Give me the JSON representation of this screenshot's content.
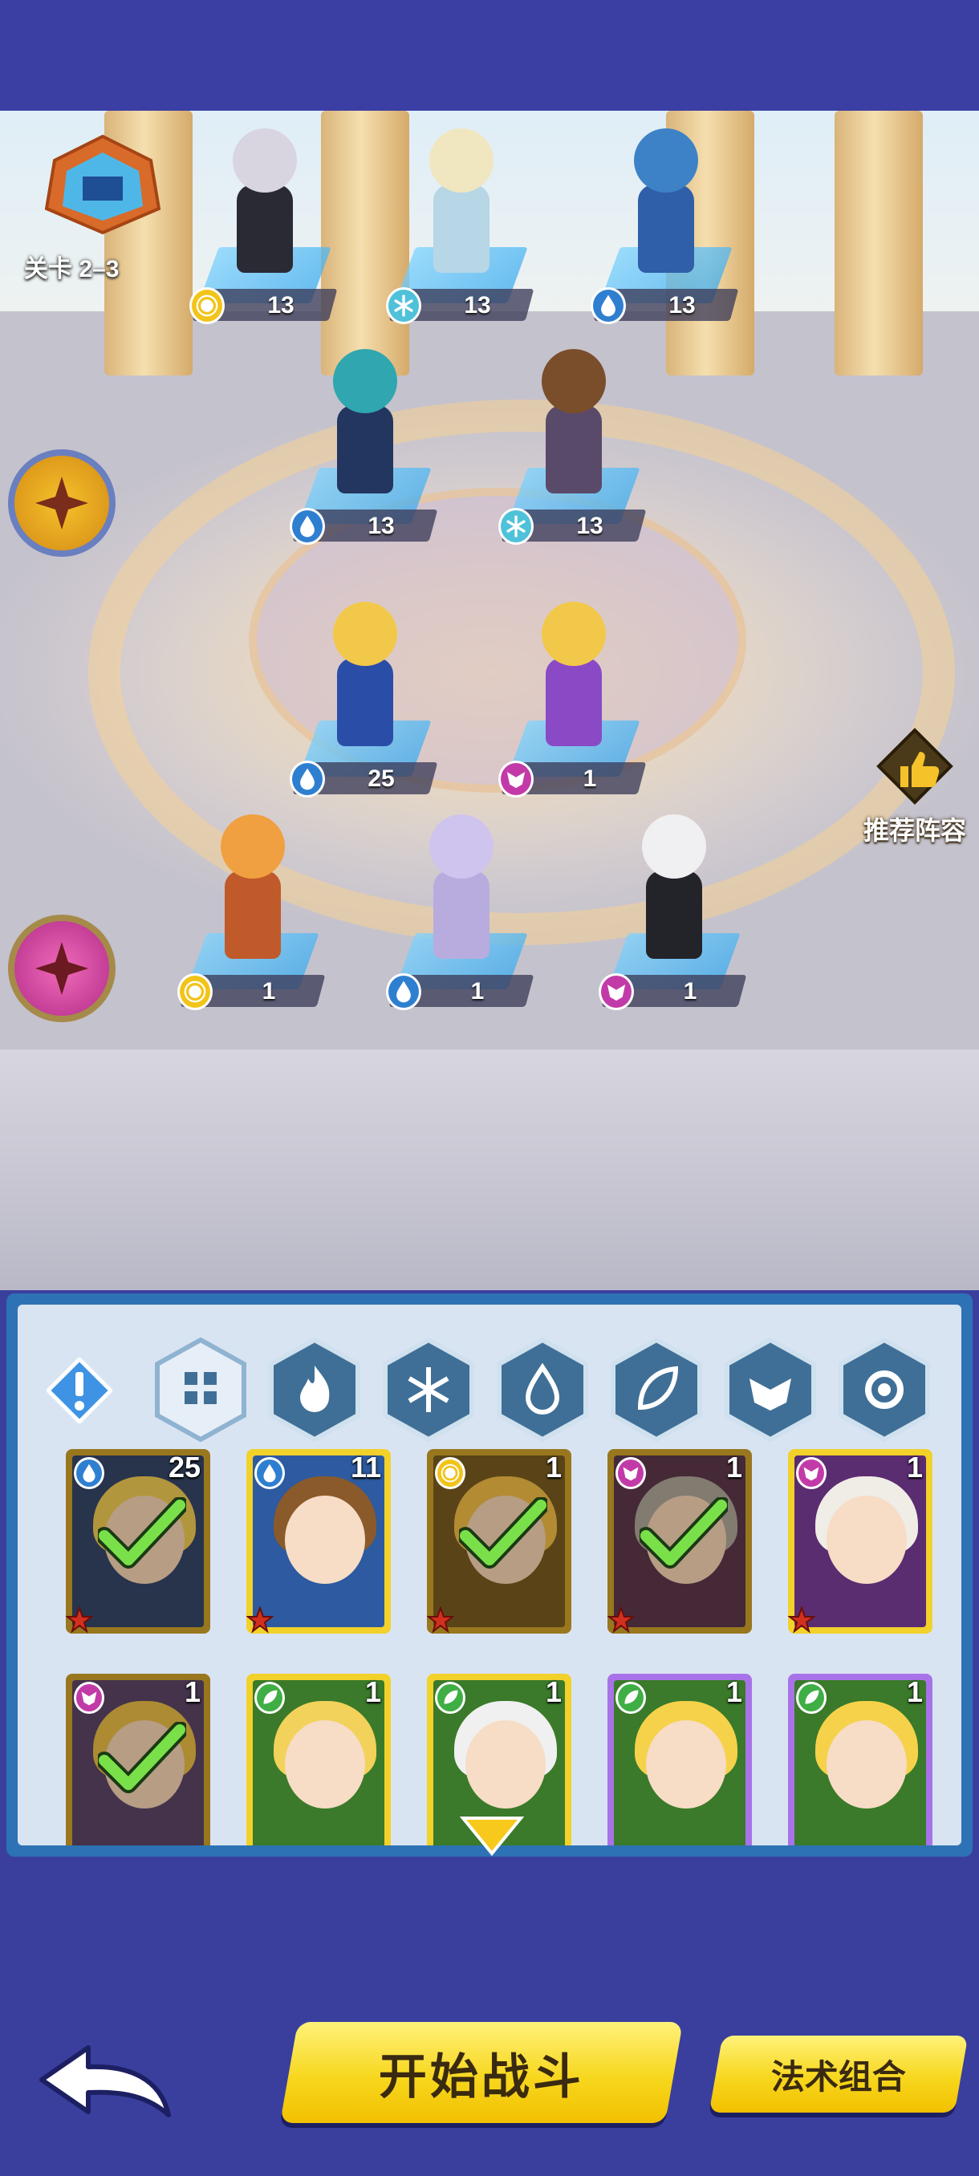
{
  "stage": {
    "label": "关卡 2–3"
  },
  "recommend": {
    "label": "推荐阵容"
  },
  "heroes": [
    {
      "element": "light",
      "level": "13"
    },
    {
      "element": "ice",
      "level": "13"
    },
    {
      "element": "water",
      "level": "13"
    },
    {
      "element": "water",
      "level": "13"
    },
    {
      "element": "ice",
      "level": "13"
    },
    {
      "element": "water",
      "level": "25"
    },
    {
      "element": "dark",
      "level": "1"
    },
    {
      "element": "light",
      "level": "1"
    },
    {
      "element": "water",
      "level": "1"
    },
    {
      "element": "dark",
      "level": "1"
    }
  ],
  "filters": [
    "all-icon",
    "fire-icon",
    "ice-icon",
    "water-icon",
    "leaf-icon",
    "dark-icon",
    "light-icon"
  ],
  "roster": [
    {
      "element": "water",
      "count": "25",
      "selected": true
    },
    {
      "element": "water",
      "count": "11",
      "selected": false
    },
    {
      "element": "light",
      "count": "1",
      "selected": true
    },
    {
      "element": "dark",
      "count": "1",
      "selected": true
    },
    {
      "element": "dark",
      "count": "1",
      "selected": false
    },
    {
      "element": "dark",
      "count": "1",
      "selected": true
    },
    {
      "element": "leaf",
      "count": "1",
      "selected": false
    },
    {
      "element": "leaf",
      "count": "1",
      "selected": false
    },
    {
      "element": "leaf",
      "count": "1",
      "selected": false
    },
    {
      "element": "leaf",
      "count": "1",
      "selected": false
    }
  ],
  "buttons": {
    "start": "开始战斗",
    "combo": "法术组合"
  },
  "colors": {
    "water": "#2f7fd0",
    "ice": "#4fc1d9",
    "light": "#f2c41a",
    "dark": "#c23aa8",
    "leaf": "#3fae44",
    "accent_yellow": "#f7d71e",
    "panel_blue": "#2d72b4",
    "background": "#3a3f9e"
  }
}
